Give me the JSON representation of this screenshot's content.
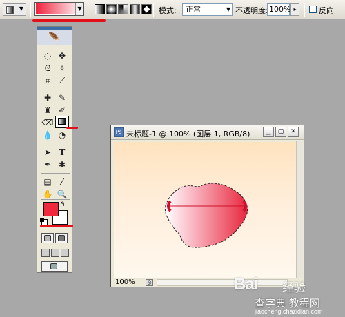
{
  "colors": {
    "foreground": "#f0283c",
    "background": "#ffffff",
    "gradient_start": "#f0203a",
    "gradient_end": "#fbe4e8",
    "annotation": "#e3101a"
  },
  "options_bar": {
    "gradient_types": [
      "linear-gradient-icon",
      "radial-gradient-icon",
      "angle-gradient-icon",
      "reflected-gradient-icon",
      "diamond-gradient-icon"
    ],
    "mode_label": "模式:",
    "mode_value": "正常",
    "opacity_label": "不透明度:",
    "opacity_value": "100%",
    "reverse_label": "反向"
  },
  "toolbox": {
    "selected_tool": "gradient-tool",
    "tools": [
      "marquee-icon",
      "move-icon",
      "lasso-icon",
      "magic-wand-icon",
      "crop-icon",
      "slice-icon",
      "healing-brush-icon",
      "brush-icon",
      "clone-stamp-icon",
      "history-brush-icon",
      "eraser-icon",
      "gradient-icon",
      "blur-icon",
      "dodge-icon",
      "path-selection-icon",
      "type-icon",
      "pen-icon",
      "shape-icon",
      "notes-icon",
      "eyedropper-icon",
      "hand-icon",
      "zoom-icon"
    ],
    "type_glyph": "T"
  },
  "document": {
    "title": "未标题-1 @ 100% (图层 1, RGB/8)",
    "zoom": "100%",
    "window_buttons": [
      "minimize",
      "maximize",
      "close"
    ]
  },
  "watermark": {
    "logo": "Bai",
    "logo_cn": "经验",
    "site": "查字典 教程网",
    "url": "jiaocheng.chazidian.com"
  }
}
